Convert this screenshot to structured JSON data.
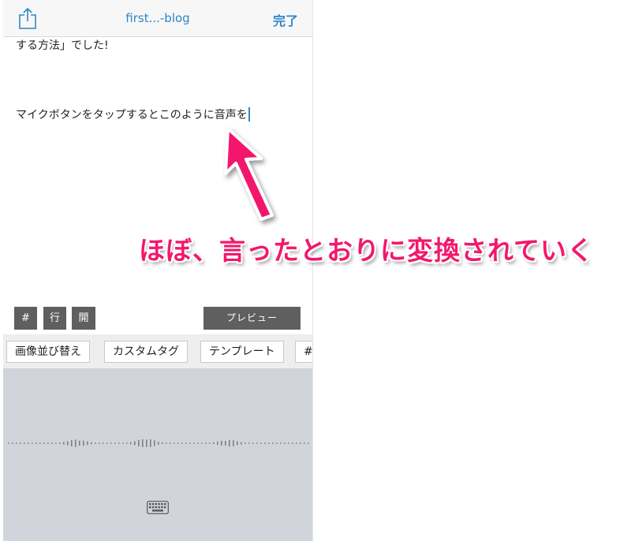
{
  "navbar": {
    "title": "first...-blog",
    "done_label": "完了",
    "share_icon": "share-icon"
  },
  "editor": {
    "line1": "する方法」でした!",
    "line2": "マイクボタンをタップするとこのように音声を"
  },
  "toolbar": {
    "hash_label": "#",
    "row_label": "行",
    "open_label": "開",
    "preview_label": "プレビュー"
  },
  "chips": [
    "画像並び替え",
    "カスタムタグ",
    "テンプレート",
    "#"
  ],
  "voice": {
    "keyboard_icon": "keyboard-icon"
  },
  "annotation": {
    "text": "ほぼ、言ったとおりに変換されていく",
    "color": "#f3186c"
  },
  "colors": {
    "accent": "#2f86c8",
    "button_dark": "#5f5f5f",
    "voice_bg": "#d2d4db"
  }
}
